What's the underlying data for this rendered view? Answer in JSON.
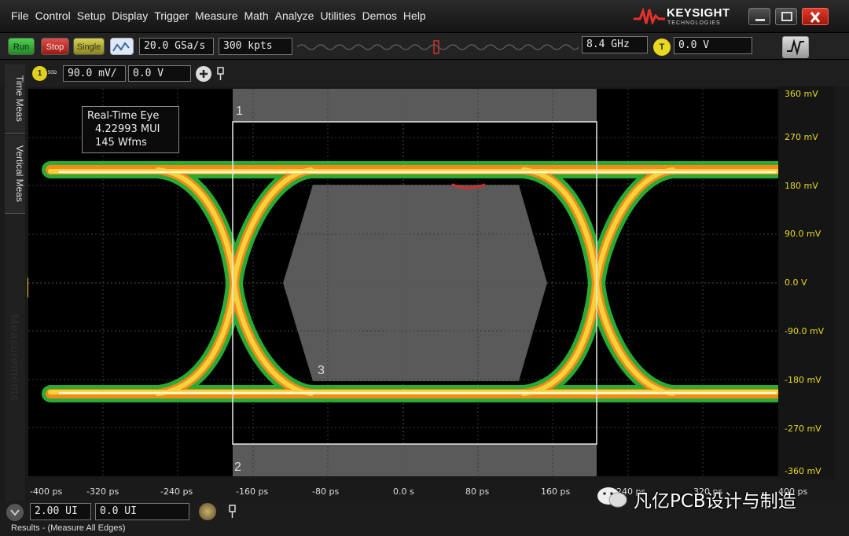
{
  "menu": [
    "File",
    "Control",
    "Setup",
    "Display",
    "Trigger",
    "Measure",
    "Math",
    "Analyze",
    "Utilities",
    "Demos",
    "Help"
  ],
  "brand": {
    "name": "KEYSIGHT",
    "sub": "TECHNOLOGIES"
  },
  "toolbar": {
    "run": "Run",
    "stop": "Stop",
    "single": "Single",
    "sample_rate": "20.0 GSa/s",
    "memory_depth": "300 kpts",
    "bandwidth": "8.4 GHz",
    "trigger_source": "T",
    "trigger_level": "0.0 V"
  },
  "channel": {
    "number": "1",
    "impedance": "50Ω",
    "scale": "90.0 mV/",
    "offset": "0.0 V"
  },
  "side_tabs": {
    "time": "Time Meas",
    "vertical": "Vertical Meas",
    "ghost": "Measurements"
  },
  "eye_info": {
    "title": "Real-Time Eye",
    "ui_count": "4.22993 MUI",
    "waveforms": "145 Wfms"
  },
  "mask_labels": {
    "top": "1",
    "bottom": "2",
    "center": "3"
  },
  "y_axis_labels": [
    "360 mV",
    "270 mV",
    "180 mV",
    "90.0 mV",
    "0.0 V",
    "-90.0 mV",
    "-180 mV",
    "-270 mV",
    "-360 mV"
  ],
  "x_axis_labels": [
    "-400 ps",
    "-320 ps",
    "-240 ps",
    "-160 ps",
    "-80 ps",
    "0.0 s",
    "80 ps",
    "160 ps",
    "240 ps",
    "320 ps",
    "400 ps"
  ],
  "horizontal": {
    "scale": "2.00 UI",
    "position": "0.0 UI"
  },
  "results_tab": "Results - (Measure All Edges)",
  "watermark": "凡亿PCB设计与制造",
  "colors": {
    "trace_yellow": "#e8d820",
    "eye_green": "#2fbf3a",
    "eye_orange": "#f28a1c",
    "mask_gray": "#5a5a5a",
    "run_green": "#2ea52e",
    "stop_red": "#c8302a"
  }
}
